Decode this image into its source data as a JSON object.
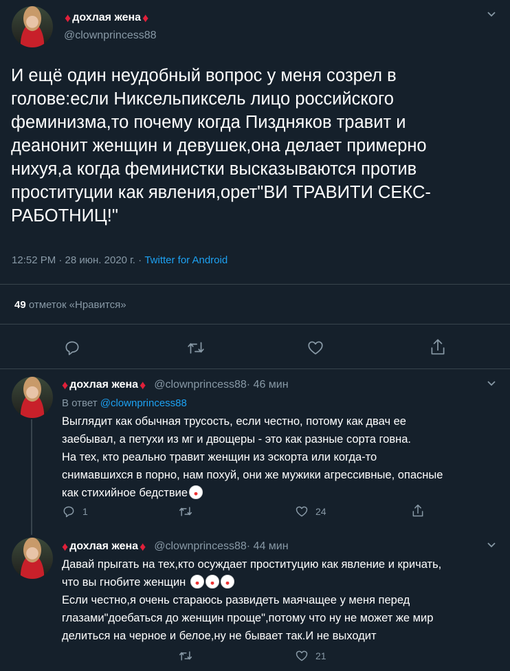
{
  "tweet": {
    "name": "дохлая жена",
    "handle": "@clownprincess88",
    "text": "И ещё один неудобный вопрос у меня созрел в\nголове:если Никсельпиксель лицо российского\nфеминизма,то почему когда Пиздняков травит и\nдеанонит женщин и девушек,она делает примерно\nнихуя,а когда феминистки высказываются против\nпроституции как явления,орет\"ВИ ТРАВИТИ СЕКС-\nРАБОТНИЦ!\"",
    "time": "12:52 PM · 28 июн. 2020 г. · ",
    "source": "Twitter for Android",
    "likes_count": "49",
    "likes_label": " отметок «Нравится»"
  },
  "replies": [
    {
      "name": "дохлая жена",
      "handle": "@clownprincess88",
      "time": " · 46 мин",
      "in_reply_prefix": "В ответ ",
      "in_reply_handle": "@clownprincess88",
      "text": "Выглядит как обычная трусость, если честно, потому как двач ее\nзаебывал, а петухи из мг и двощеры - это как разные сорта говна.\nНа тех, кто реально травит женщин из эскорта или когда-то\nснимавшихся в порно, нам похуй, они же мужики агрессивные, опасные\nкак стихийное бедствие",
      "reply_count": "1",
      "retweet_count": "",
      "like_count": "24"
    },
    {
      "name": "дохлая жена",
      "handle": "@clownprincess88",
      "time": " · 44 мин",
      "text_1": "Давай прыгать на тех,кто осуждает проституцию как явление и кричать,\nчто вы гнобите женщин ",
      "text_2": "\nЕсли честно,я очень стараюсь развидеть маячащее у меня перед\nглазами\"доебаться до женщин проще\",потому что ну не может же мир\nделиться на черное и белое,ну не бывает так.И не выходит",
      "like_count": "21"
    }
  ],
  "icons": {
    "reply": "reply-icon",
    "retweet": "retweet-icon",
    "like": "heart-icon",
    "share": "share-icon",
    "more": "chevron-down-icon",
    "emoji": "clown-face-emoji"
  },
  "colors": {
    "background": "#15202b",
    "accent": "#1da1f2",
    "muted": "#8899a6",
    "diamond": "#e0203a"
  }
}
